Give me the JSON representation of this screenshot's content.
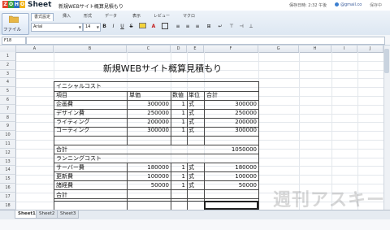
{
  "app": {
    "logo_letters": [
      "Z",
      "O",
      "H",
      "O"
    ],
    "logo_colors": [
      "#e2452b",
      "#3ba043",
      "#2d72c5",
      "#f2b41a"
    ],
    "logo_word": "Sheet",
    "doc_title": "新規WEBサイト概算見積もり",
    "saved_text": "保存日時: 2:32 午後",
    "user_email": "@gmail.co",
    "save_label": "保存中"
  },
  "ribbon": {
    "file_label": "ファイル",
    "tabs": [
      "書式設定",
      "挿入",
      "形式",
      "データ",
      "表示",
      "レビュー",
      "マクロ"
    ],
    "active_tab": 0,
    "font_name": "Arial",
    "font_size": "14"
  },
  "formula_bar": {
    "cell_ref": "F18",
    "formula": ""
  },
  "columns": [
    "A",
    "B",
    "C",
    "D",
    "E",
    "F",
    "G",
    "H",
    "I",
    "J"
  ],
  "rows": [
    "1",
    "2",
    "3",
    "4",
    "5",
    "6",
    "7",
    "8",
    "9",
    "10",
    "11",
    "12",
    "13",
    "14",
    "15",
    "16",
    "17",
    "18",
    "19"
  ],
  "sheet": {
    "title": "新規WEBサイト概算見積もり",
    "initial_section": "イニシャルコスト",
    "headers": {
      "item": "項目",
      "price": "単価",
      "qty": "数値",
      "unit": "単位",
      "total": "合計"
    },
    "initial_items": [
      {
        "item": "企画費",
        "price": "300000",
        "qty": "1",
        "unit": "式",
        "total": "300000"
      },
      {
        "item": "デザイン費",
        "price": "250000",
        "qty": "1",
        "unit": "式",
        "total": "250000"
      },
      {
        "item": "ライティング",
        "price": "200000",
        "qty": "1",
        "unit": "式",
        "total": "200000"
      },
      {
        "item": "コーディング",
        "price": "300000",
        "qty": "1",
        "unit": "式",
        "total": "300000"
      }
    ],
    "initial_total_label": "合計",
    "initial_total": "1050000",
    "running_section": "ランニングコスト",
    "running_items": [
      {
        "item": "サーバー費",
        "price": "180000",
        "qty": "1",
        "unit": "式",
        "total": "180000"
      },
      {
        "item": "更新費",
        "price": "100000",
        "qty": "1",
        "unit": "式",
        "total": "100000"
      },
      {
        "item": "諸経費",
        "price": "50000",
        "qty": "1",
        "unit": "式",
        "total": "50000"
      }
    ],
    "running_total_label": "合計"
  },
  "sheet_tabs": [
    "Sheet1",
    "Sheet2",
    "Sheet3"
  ],
  "active_sheet": 0,
  "watermark": "週刊アスキー"
}
